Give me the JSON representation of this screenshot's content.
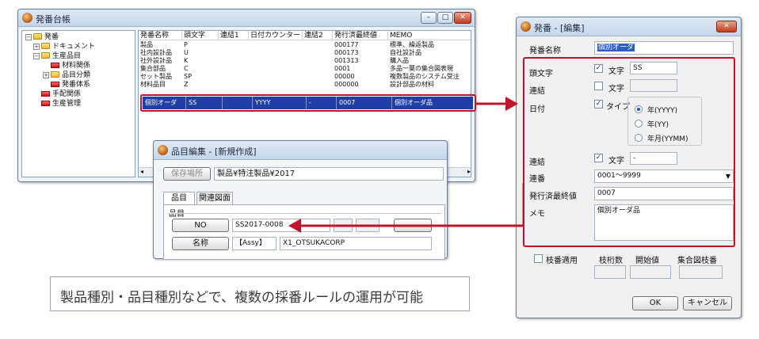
{
  "main_window": {
    "title": "発番台帳",
    "controls": {
      "minimize": "–",
      "maximize": "□",
      "close": "✕"
    },
    "tree": [
      {
        "label": "発番",
        "icon": "folder-icon"
      },
      {
        "label": "ドキュメント",
        "icon": "folder-icon"
      },
      {
        "label": "生産品目",
        "icon": "folder-icon"
      },
      {
        "label": "材料関係",
        "icon": "red-folder-icon"
      },
      {
        "label": "品目分類",
        "icon": "folder-icon"
      },
      {
        "label": "発番体系",
        "icon": "red-folder-icon"
      },
      {
        "label": "手配関係",
        "icon": "red-folder-icon"
      },
      {
        "label": "生産管理",
        "icon": "red-folder-icon"
      }
    ],
    "grid": {
      "headers": [
        "発番名称",
        "頭文字",
        "連結1",
        "日付カウンター",
        "連結2",
        "発行済最終値",
        "MEMO"
      ],
      "rows": [
        [
          "製品",
          "P",
          "",
          "",
          "",
          "000177",
          "標準、繰返製品"
        ],
        [
          "社内設計品",
          "U",
          "",
          "",
          "",
          "000173",
          "自社設計品"
        ],
        [
          "社外設計品",
          "K",
          "",
          "",
          "",
          "001313",
          "購入品"
        ],
        [
          "集合部品",
          "C",
          "",
          "",
          "",
          "0001",
          "多品一葉の集合図表現"
        ],
        [
          "セット製品",
          "SP",
          "",
          "",
          "",
          "00000",
          "複数製品のシステム受注"
        ],
        [
          "材料品目",
          "Z",
          "",
          "",
          "",
          "000000",
          "設計部品の材料"
        ]
      ],
      "selected": [
        "個別オーダ",
        "SS",
        "",
        "YYYY",
        "-",
        "0007",
        "個別オーダ品"
      ]
    }
  },
  "item_window": {
    "title": "品目編集 - [新規作成]",
    "save_location_label": "保存場所",
    "save_location_value": "製品¥特注製品¥2017",
    "tabs": [
      "品目",
      "関連図面"
    ],
    "group_label": "品目",
    "no_button": "NO",
    "no_value": "SS2017-0008",
    "name_button": "名称",
    "name_prefix": "【Assy】",
    "name_value": "X1_OTSUKACORP"
  },
  "caption": "製品種別・品目種別などで、複数の採番ルールの運用が可能",
  "edit_dialog": {
    "title": "発番 - [編集]",
    "close": "✕",
    "name_label": "発番名称",
    "name_value": "個別オーダ",
    "prefix_label": "頭文字",
    "prefix_check": "✓",
    "prefix_text_label": "文字",
    "prefix_value": "SS",
    "link1_label": "連結",
    "link1_text_label": "文字",
    "link1_value": "",
    "date_label": "日付",
    "date_check": "✓",
    "date_type_label": "タイプ",
    "date_options": [
      "年(YYYY)",
      "年(YY)",
      "年月(YYMM)"
    ],
    "date_selected": "年(YYYY)",
    "link2_label": "連結",
    "link2_check": "✓",
    "link2_text_label": "文字",
    "link2_value": "-",
    "serial_label": "連番",
    "serial_value": "0001～9999",
    "last_label": "発行済最終値",
    "last_value": "0007",
    "memo_label": "メモ",
    "memo_value": "個別オーダ品",
    "branch_label": "枝番適用",
    "branch_digits_label": "枝桁数",
    "branch_start_label": "開始値",
    "branch_assembly_label": "集合図枝番",
    "ok_button": "OK",
    "cancel_button": "キャンセル"
  },
  "colors": {
    "accent_red": "#c0142a",
    "selection_blue": "#1f3fa8"
  }
}
